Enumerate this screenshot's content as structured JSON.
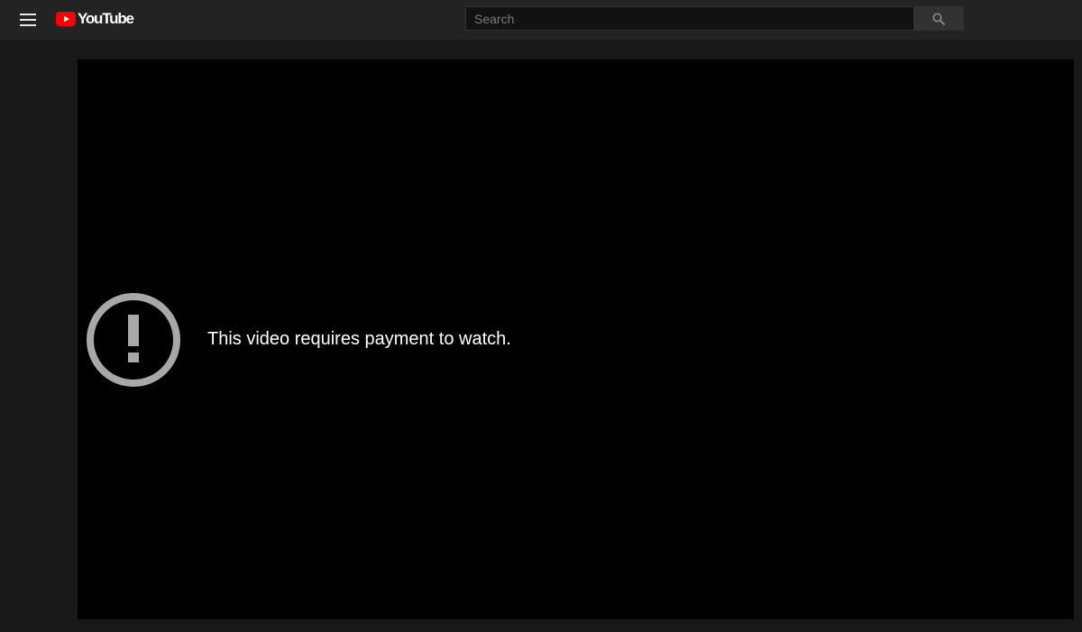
{
  "header": {
    "logo_text": "YouTube",
    "brand_color": "#ff0000",
    "menu_icon": "hamburger-menu-icon",
    "search": {
      "placeholder": "Search",
      "value": "",
      "button_icon": "search-icon"
    }
  },
  "player": {
    "error_icon": "exclamation-circle-icon",
    "message": "This video requires payment to watch."
  }
}
